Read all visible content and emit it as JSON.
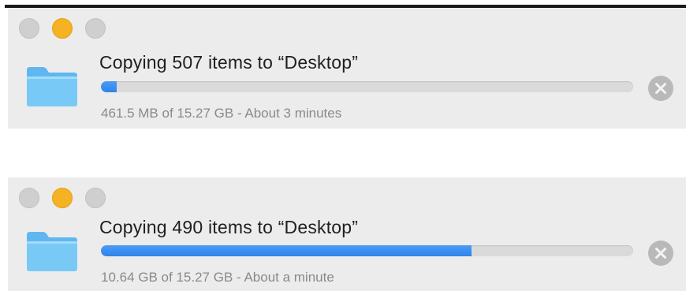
{
  "dialogs": [
    {
      "title": "Copying 507 items to “Desktop”",
      "status": "461.5 MB of 15.27 GB - About 3 minutes",
      "progress_fraction": 0.0295
    },
    {
      "title": "Copying 490 items to “Desktop”",
      "status": "10.64 GB of 15.27 GB - About a minute",
      "progress_fraction": 0.697
    }
  ],
  "colors": {
    "progress_fill": "#2f83eb",
    "progress_track": "#dadada",
    "close_button": "#cfcfcf",
    "minimize_button": "#f5b324",
    "zoom_button": "#cfcfcf",
    "folder": "#6cc3f5",
    "cancel_button": "#b9b9b9"
  },
  "icons": {
    "window_controls": [
      "close-button",
      "minimize-button",
      "zoom-button"
    ],
    "file_icon": "folder-icon",
    "cancel": "cancel-icon"
  }
}
